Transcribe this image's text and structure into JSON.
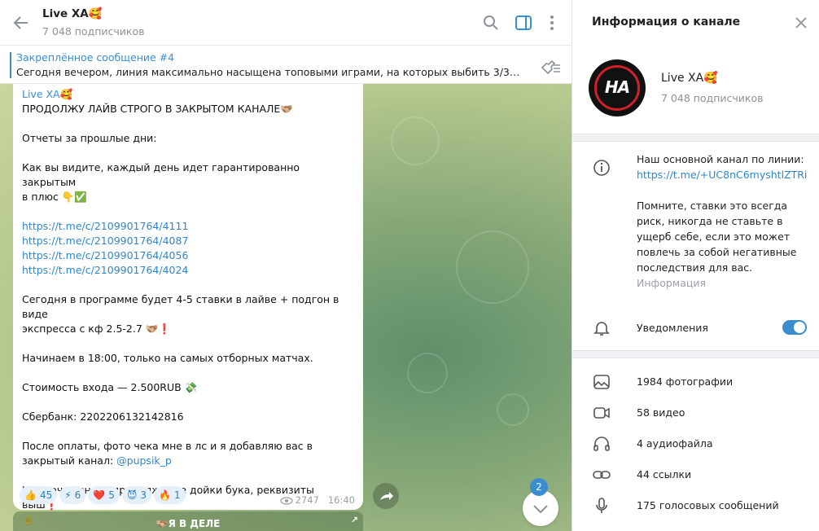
{
  "chat": {
    "title": "Live XA🥰",
    "subscribers": "7 048 подписчиков"
  },
  "pinned": {
    "title": "Закреплённое сообщение #4",
    "text": "Сегодня вечером, линия максимально насыщена топовыми играми, на которых выбить 3/3✅ п..."
  },
  "message": {
    "author": "Live XA🥰",
    "lines": [
      "ПРОДОЛЖУ ЛАЙВ СТРОГО В ЗАКРЫТОМ КАНАЛЕ🫱🏼‍🫲🏽",
      "",
      "Отчеты за прошлые дни:",
      "",
      "Как вы видите, каждый день идет гарантированно закрытым",
      "в плюс 👇✅",
      "",
      "https://t.me/c/2109901764/4111",
      "https://t.me/c/2109901764/4087",
      "https://t.me/c/2109901764/4056",
      "https://t.me/c/2109901764/4024",
      "",
      "Сегодня в программе будет 4-5 ставки в лайве + подгон в виде",
      "экспресса с кф 2.5-2.7 🫱🏼‍🫲🏽❗️",
      "",
      "Начинаем в 18:00, только на самых отборных матчах.",
      "",
      "Стоимость входа — 2.500RUB 💸",
      "",
      "Сбербанк:  2202206132142816",
      "",
      "После оплаты, фото чека мне в лс и я добавляю вас в",
      "закрытый канал: @pupsik_p",
      "",
      "Кто хочет вновь продолжение дойки бука, реквизиты выш❗️",
      "☝️"
    ],
    "reactions": [
      {
        "emoji": "👍",
        "count": "45"
      },
      {
        "emoji": "⚡",
        "count": "6"
      },
      {
        "emoji": "❤️",
        "count": "5"
      },
      {
        "emoji": "😈",
        "count": "3"
      },
      {
        "emoji": "🔥",
        "count": "1"
      }
    ],
    "views": "2747",
    "time": "16:40"
  },
  "unread_count": "2",
  "bottom_button": "🫱🏼‍🫲🏽Я В ДЕЛЕ",
  "info": {
    "title": "Информация о канале",
    "name": "Live XA🥰",
    "subscribers": "7 048 подписчиков",
    "avatar_text": "HA",
    "about_line1": "Наш основной канал по линии:",
    "about_link": "https://t.me/+UC8nC6myshtlZTRi",
    "about_text": "Помните, ставки это всегда риск, никогда не ставьте в ущерб себе, если это может повлечь за собой негативные последствия для вас.",
    "about_label": "Информация",
    "notifications_label": "Уведомления",
    "notifications_on": true,
    "media": [
      {
        "icon": "photo-icon",
        "label": "1984 фотографии"
      },
      {
        "icon": "video-icon",
        "label": "58 видео"
      },
      {
        "icon": "headphones-icon",
        "label": "4 аудиофайла"
      },
      {
        "icon": "link-icon",
        "label": "44 ссылки"
      },
      {
        "icon": "microphone-icon",
        "label": "175 голосовых сообщений"
      }
    ]
  },
  "colors": {
    "accent": "#3a8ed0",
    "link": "#2f87c9",
    "reaction_bg": "#e6f0fa"
  }
}
